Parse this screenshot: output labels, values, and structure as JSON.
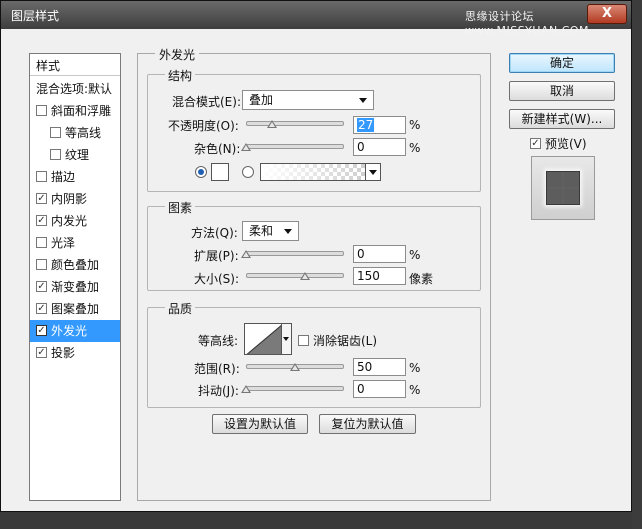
{
  "window": {
    "title": "图层样式",
    "watermark": "思缘设计论坛 www.MISSYUAN.COM",
    "close_label": "X"
  },
  "styles_panel": {
    "header": "样式",
    "items": [
      {
        "label": "混合选项:默认",
        "checkbox": false,
        "checked": false,
        "indent": false,
        "selected": false
      },
      {
        "label": "斜面和浮雕",
        "checkbox": true,
        "checked": false,
        "indent": false,
        "selected": false
      },
      {
        "label": "等高线",
        "checkbox": true,
        "checked": false,
        "indent": true,
        "selected": false
      },
      {
        "label": "纹理",
        "checkbox": true,
        "checked": false,
        "indent": true,
        "selected": false
      },
      {
        "label": "描边",
        "checkbox": true,
        "checked": false,
        "indent": false,
        "selected": false
      },
      {
        "label": "内阴影",
        "checkbox": true,
        "checked": true,
        "indent": false,
        "selected": false
      },
      {
        "label": "内发光",
        "checkbox": true,
        "checked": true,
        "indent": false,
        "selected": false
      },
      {
        "label": "光泽",
        "checkbox": true,
        "checked": false,
        "indent": false,
        "selected": false
      },
      {
        "label": "颜色叠加",
        "checkbox": true,
        "checked": false,
        "indent": false,
        "selected": false
      },
      {
        "label": "渐变叠加",
        "checkbox": true,
        "checked": true,
        "indent": false,
        "selected": false
      },
      {
        "label": "图案叠加",
        "checkbox": true,
        "checked": true,
        "indent": false,
        "selected": false
      },
      {
        "label": "外发光",
        "checkbox": true,
        "checked": true,
        "indent": false,
        "selected": true
      },
      {
        "label": "投影",
        "checkbox": true,
        "checked": true,
        "indent": false,
        "selected": false
      }
    ]
  },
  "outer_glow": {
    "title": "外发光",
    "structure": {
      "title": "结构",
      "blend_mode_label": "混合模式(E):",
      "blend_mode_value": "叠加",
      "opacity_label": "不透明度(O):",
      "opacity_value": "27",
      "opacity_unit": "%",
      "noise_label": "杂色(N):",
      "noise_value": "0",
      "noise_unit": "%"
    },
    "elements": {
      "title": "图素",
      "technique_label": "方法(Q):",
      "technique_value": "柔和",
      "spread_label": "扩展(P):",
      "spread_value": "0",
      "spread_unit": "%",
      "size_label": "大小(S):",
      "size_value": "150",
      "size_unit": "像素"
    },
    "quality": {
      "title": "品质",
      "contour_label": "等高线:",
      "antialias_label": "消除锯齿(L)",
      "range_label": "范围(R):",
      "range_value": "50",
      "range_unit": "%",
      "jitter_label": "抖动(J):",
      "jitter_value": "0",
      "jitter_unit": "%"
    },
    "make_default_label": "设置为默认值",
    "reset_default_label": "复位为默认值"
  },
  "sliders": {
    "opacity": 0.27,
    "noise": 0,
    "spread": 0,
    "size": 0.6,
    "range": 0.5,
    "jitter": 0
  },
  "buttons": {
    "ok": "确定",
    "cancel": "取消",
    "new_style": "新建样式(W)...",
    "preview_label": "预览(V)"
  },
  "colors": {
    "selection": "#3399ff",
    "glow_color": "#ffffff"
  }
}
